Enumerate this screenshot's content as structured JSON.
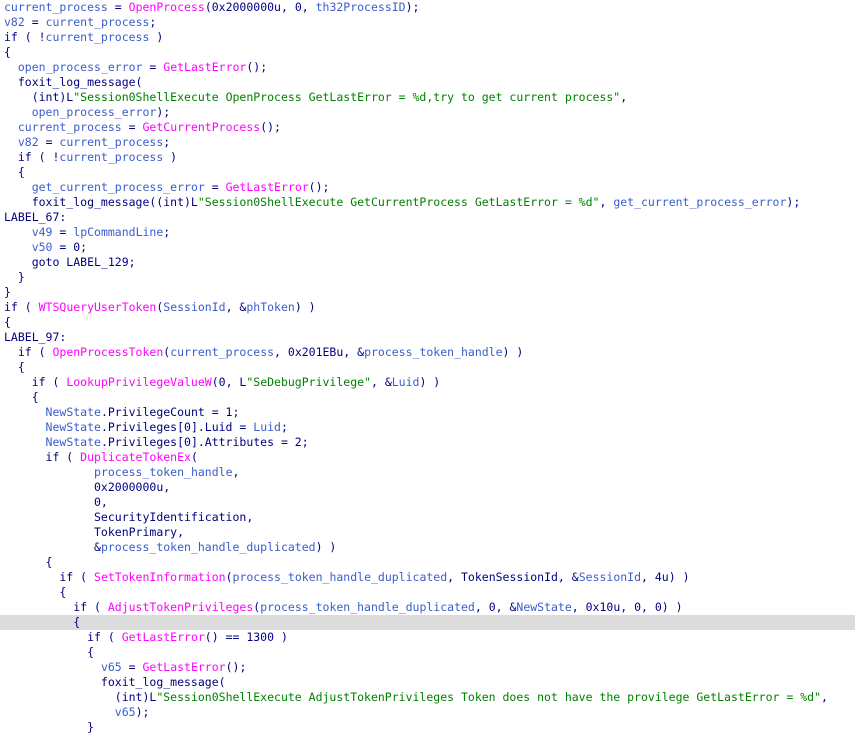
{
  "window": {
    "type": "decompiler-pseudocode-view",
    "highlighted_line_index": 41
  },
  "colors": {
    "background": "#ffffff",
    "plain": "#000080",
    "variable": "#3a5dcc",
    "function": "#ff00ff",
    "string": "#008000",
    "current_line": "#dcdcdc"
  },
  "lines": [
    [
      [
        "v",
        "current_process"
      ],
      [
        "p",
        " = "
      ],
      [
        "f",
        "OpenProcess"
      ],
      [
        "p",
        "(0x2000000u, 0, "
      ],
      [
        "v",
        "th32ProcessID"
      ],
      [
        "p",
        ");"
      ]
    ],
    [
      [
        "v",
        "v82"
      ],
      [
        "p",
        " = "
      ],
      [
        "v",
        "current_process"
      ],
      [
        "p",
        ";"
      ]
    ],
    [
      [
        "p",
        "if ( !"
      ],
      [
        "v",
        "current_process"
      ],
      [
        "p",
        " )"
      ]
    ],
    [
      [
        "p",
        "{"
      ]
    ],
    [
      [
        "p",
        "  "
      ],
      [
        "v",
        "open_process_error"
      ],
      [
        "p",
        " = "
      ],
      [
        "f",
        "GetLastError"
      ],
      [
        "p",
        "();"
      ]
    ],
    [
      [
        "p",
        "  foxit_log_message("
      ]
    ],
    [
      [
        "p",
        "    (int)L"
      ],
      [
        "s",
        "\"Session0ShellExecute OpenProcess GetLastError = %d,try to get current process\""
      ],
      [
        "p",
        ","
      ]
    ],
    [
      [
        "p",
        "    "
      ],
      [
        "v",
        "open_process_error"
      ],
      [
        "p",
        ");"
      ]
    ],
    [
      [
        "p",
        "  "
      ],
      [
        "v",
        "current_process"
      ],
      [
        "p",
        " = "
      ],
      [
        "f",
        "GetCurrentProcess"
      ],
      [
        "p",
        "();"
      ]
    ],
    [
      [
        "p",
        "  "
      ],
      [
        "v",
        "v82"
      ],
      [
        "p",
        " = "
      ],
      [
        "v",
        "current_process"
      ],
      [
        "p",
        ";"
      ]
    ],
    [
      [
        "p",
        "  if ( !"
      ],
      [
        "v",
        "current_process"
      ],
      [
        "p",
        " )"
      ]
    ],
    [
      [
        "p",
        "  {"
      ]
    ],
    [
      [
        "p",
        "    "
      ],
      [
        "v",
        "get_current_process_error"
      ],
      [
        "p",
        " = "
      ],
      [
        "f",
        "GetLastError"
      ],
      [
        "p",
        "();"
      ]
    ],
    [
      [
        "p",
        "    foxit_log_message((int)L"
      ],
      [
        "s",
        "\"Session0ShellExecute GetCurrentProcess GetLastError = %d\""
      ],
      [
        "p",
        ", "
      ],
      [
        "v",
        "get_current_process_error"
      ],
      [
        "p",
        ");"
      ]
    ],
    [
      [
        "l",
        "LABEL_67:"
      ]
    ],
    [
      [
        "p",
        "    "
      ],
      [
        "v",
        "v49"
      ],
      [
        "p",
        " = "
      ],
      [
        "v",
        "lpCommandLine"
      ],
      [
        "p",
        ";"
      ]
    ],
    [
      [
        "p",
        "    "
      ],
      [
        "v",
        "v50"
      ],
      [
        "p",
        " = 0;"
      ]
    ],
    [
      [
        "p",
        "    goto LABEL_129;"
      ]
    ],
    [
      [
        "p",
        "  }"
      ]
    ],
    [
      [
        "p",
        "}"
      ]
    ],
    [
      [
        "p",
        "if ( "
      ],
      [
        "f",
        "WTSQueryUserToken"
      ],
      [
        "p",
        "("
      ],
      [
        "v",
        "SessionId"
      ],
      [
        "p",
        ", &"
      ],
      [
        "v",
        "phToken"
      ],
      [
        "p",
        ") )"
      ]
    ],
    [
      [
        "p",
        "{"
      ]
    ],
    [
      [
        "l",
        "LABEL_97:"
      ]
    ],
    [
      [
        "p",
        "  if ( "
      ],
      [
        "f",
        "OpenProcessToken"
      ],
      [
        "p",
        "("
      ],
      [
        "v",
        "current_process"
      ],
      [
        "p",
        ", 0x201EBu, &"
      ],
      [
        "v",
        "process_token_handle"
      ],
      [
        "p",
        ") )"
      ]
    ],
    [
      [
        "p",
        "  {"
      ]
    ],
    [
      [
        "p",
        "    if ( "
      ],
      [
        "f",
        "LookupPrivilegeValueW"
      ],
      [
        "p",
        "(0, L"
      ],
      [
        "s",
        "\"SeDebugPrivilege\""
      ],
      [
        "p",
        ", &"
      ],
      [
        "v",
        "Luid"
      ],
      [
        "p",
        ") )"
      ]
    ],
    [
      [
        "p",
        "    {"
      ]
    ],
    [
      [
        "p",
        "      "
      ],
      [
        "v",
        "NewState"
      ],
      [
        "p",
        ".PrivilegeCount = 1;"
      ]
    ],
    [
      [
        "p",
        "      "
      ],
      [
        "v",
        "NewState"
      ],
      [
        "p",
        ".Privileges[0].Luid = "
      ],
      [
        "v",
        "Luid"
      ],
      [
        "p",
        ";"
      ]
    ],
    [
      [
        "p",
        "      "
      ],
      [
        "v",
        "NewState"
      ],
      [
        "p",
        ".Privileges[0].Attributes = 2;"
      ]
    ],
    [
      [
        "p",
        "      if ( "
      ],
      [
        "f",
        "DuplicateTokenEx"
      ],
      [
        "p",
        "("
      ]
    ],
    [
      [
        "p",
        "             "
      ],
      [
        "v",
        "process_token_handle"
      ],
      [
        "p",
        ","
      ]
    ],
    [
      [
        "p",
        "             0x2000000u,"
      ]
    ],
    [
      [
        "p",
        "             0,"
      ]
    ],
    [
      [
        "p",
        "             SecurityIdentification,"
      ]
    ],
    [
      [
        "p",
        "             TokenPrimary,"
      ]
    ],
    [
      [
        "p",
        "             &"
      ],
      [
        "v",
        "process_token_handle_duplicated"
      ],
      [
        "p",
        ") )"
      ]
    ],
    [
      [
        "p",
        "      {"
      ]
    ],
    [
      [
        "p",
        "        if ( "
      ],
      [
        "f",
        "SetTokenInformation"
      ],
      [
        "p",
        "("
      ],
      [
        "v",
        "process_token_handle_duplicated"
      ],
      [
        "p",
        ", TokenSessionId, &"
      ],
      [
        "v",
        "SessionId"
      ],
      [
        "p",
        ", 4u) )"
      ]
    ],
    [
      [
        "p",
        "        {"
      ]
    ],
    [
      [
        "p",
        "          if ( "
      ],
      [
        "f",
        "AdjustTokenPrivileges"
      ],
      [
        "p",
        "("
      ],
      [
        "v",
        "process_token_handle_duplicated"
      ],
      [
        "p",
        ", 0, &"
      ],
      [
        "v",
        "NewState"
      ],
      [
        "p",
        ", 0x10u, 0, 0) )"
      ]
    ],
    [
      [
        "p",
        "          {"
      ]
    ],
    [
      [
        "p",
        "            if ( "
      ],
      [
        "f",
        "GetLastError"
      ],
      [
        "p",
        "() == 1300 )"
      ]
    ],
    [
      [
        "p",
        "            {"
      ]
    ],
    [
      [
        "p",
        "              "
      ],
      [
        "v",
        "v65"
      ],
      [
        "p",
        " = "
      ],
      [
        "f",
        "GetLastError"
      ],
      [
        "p",
        "();"
      ]
    ],
    [
      [
        "p",
        "              foxit_log_message("
      ]
    ],
    [
      [
        "p",
        "                (int)L"
      ],
      [
        "s",
        "\"Session0ShellExecute AdjustTokenPrivileges Token does not have the provilege GetLastError = %d\""
      ],
      [
        "p",
        ","
      ]
    ],
    [
      [
        "p",
        "                "
      ],
      [
        "v",
        "v65"
      ],
      [
        "p",
        ");"
      ]
    ],
    [
      [
        "p",
        "            }"
      ]
    ]
  ]
}
